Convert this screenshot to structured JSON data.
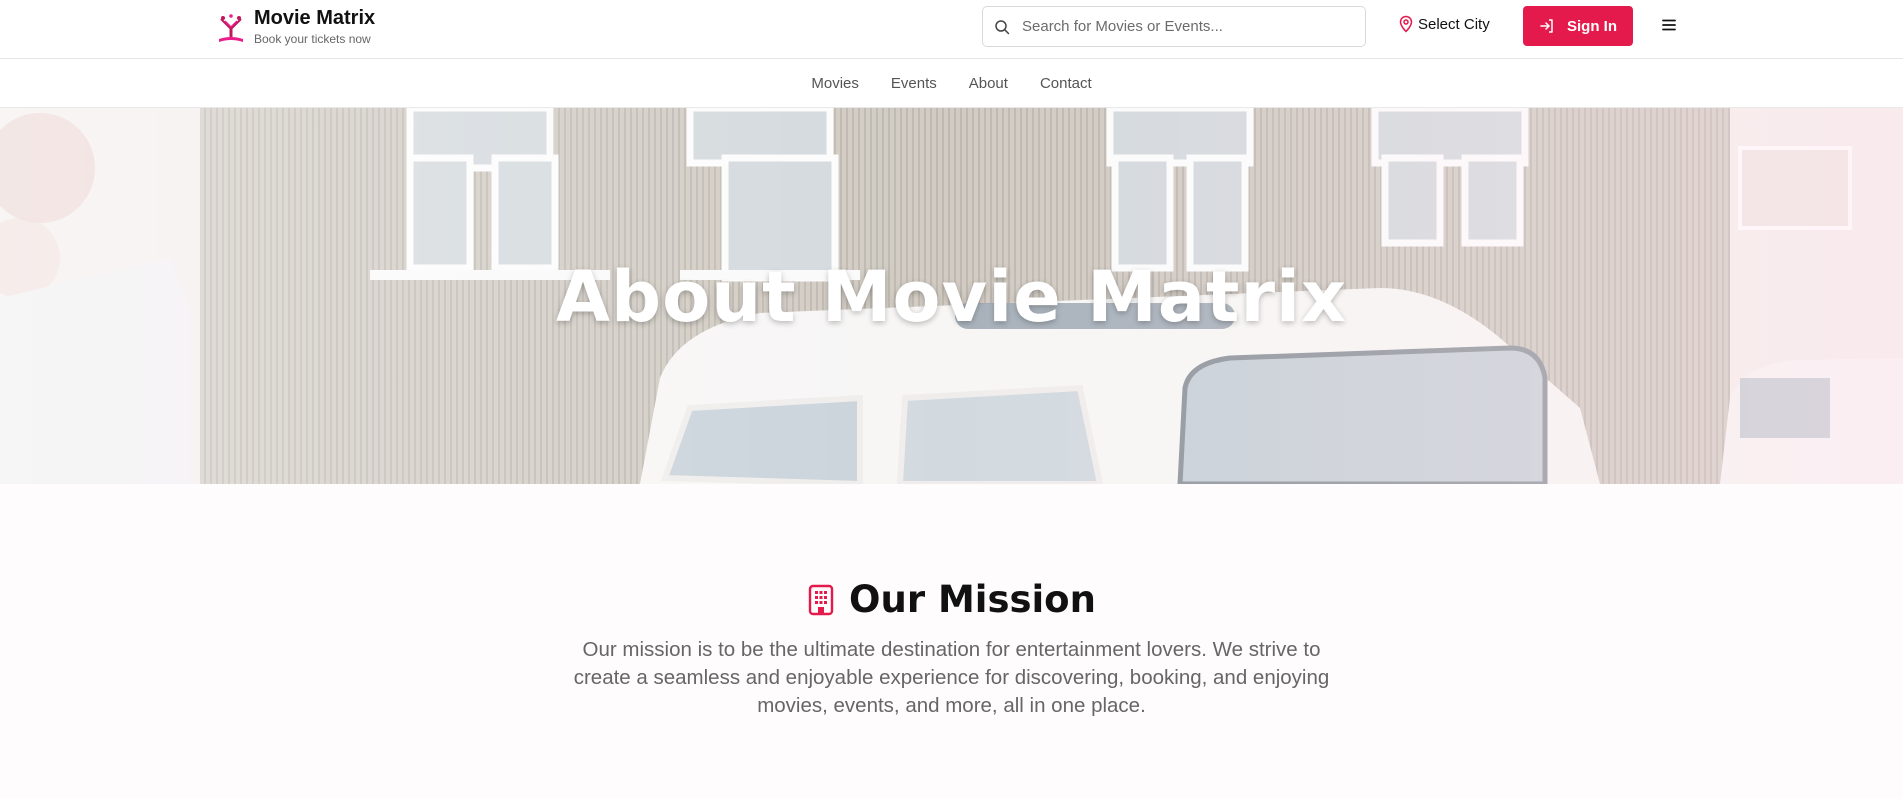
{
  "brand": {
    "title": "Movie Matrix",
    "subtitle": "Book your tickets now",
    "logo_icon": "popcorn-ticket-icon"
  },
  "search": {
    "placeholder": "Search for Movies or Events...",
    "value": "",
    "icon": "search-icon"
  },
  "city": {
    "label": "Select City",
    "icon": "map-pin-icon"
  },
  "signin": {
    "label": "Sign In",
    "icon": "login-arrow-icon"
  },
  "menu": {
    "icon": "hamburger-menu-icon"
  },
  "nav": {
    "items": [
      {
        "label": "Movies"
      },
      {
        "label": "Events"
      },
      {
        "label": "About"
      },
      {
        "label": "Contact"
      }
    ]
  },
  "hero": {
    "title": "About Movie Matrix",
    "image": "faded-photo-white-van-house"
  },
  "mission": {
    "title": "Our Mission",
    "icon": "building-icon",
    "text": "Our mission is to be the ultimate destination for entertainment lovers. We strive to create a seamless and enjoyable experience for discovering, booking, and enjoying movies, events, and more, all in one place."
  },
  "colors": {
    "accent": "#e51a4c",
    "text": "#111111",
    "muted": "#666666"
  }
}
